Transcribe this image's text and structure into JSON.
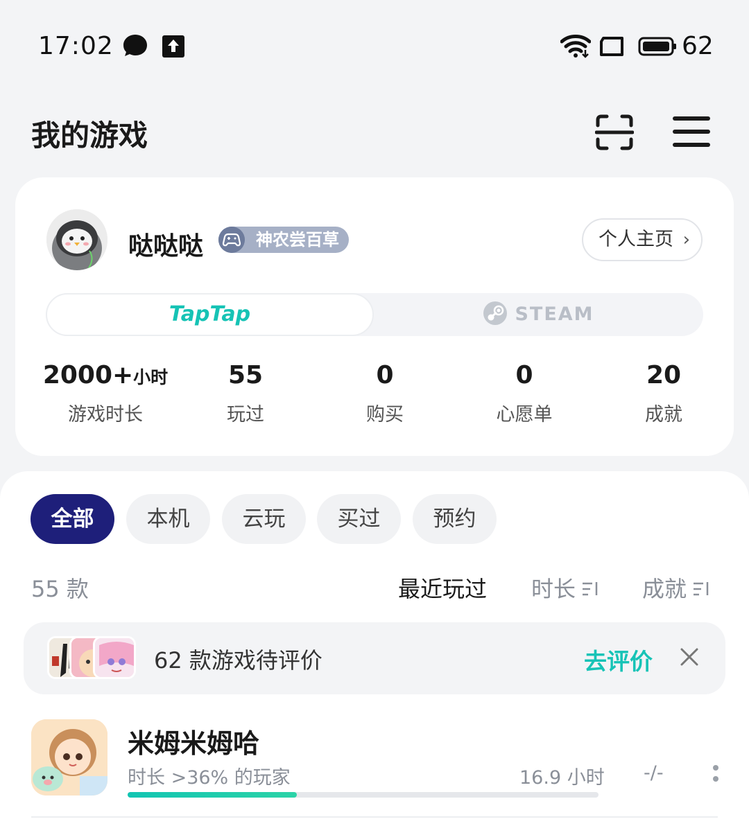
{
  "status_bar": {
    "time": "17:02",
    "battery": "62",
    "icons": [
      "chat-bubble-icon",
      "upload-icon",
      "wifi-icon",
      "screen-cast-icon",
      "battery-icon"
    ]
  },
  "header": {
    "title": "我的游戏",
    "icons": [
      "scan-icon",
      "menu-icon"
    ]
  },
  "profile": {
    "username": "哒哒哒",
    "badge": "神农尝百草",
    "profile_button": "个人主页",
    "chevron": "›"
  },
  "platforms": {
    "taptap": "TapTap",
    "steam": "STEAM",
    "active": "taptap"
  },
  "stats": [
    {
      "value": "2000+",
      "unit": "小时",
      "label": "游戏时长"
    },
    {
      "value": "55",
      "unit": "",
      "label": "玩过"
    },
    {
      "value": "0",
      "unit": "",
      "label": "购买"
    },
    {
      "value": "0",
      "unit": "",
      "label": "心愿单"
    },
    {
      "value": "20",
      "unit": "",
      "label": "成就"
    }
  ],
  "filters": [
    "全部",
    "本机",
    "云玩",
    "买过",
    "预约"
  ],
  "active_filter": "全部",
  "list": {
    "count": "55 款",
    "sort_recent": "最近玩过",
    "sort_duration": "时长",
    "sort_achievement": "成就"
  },
  "review_bar": {
    "text": "62 款游戏待评价",
    "link": "去评价"
  },
  "games": [
    {
      "name": "米姆米姆哈",
      "rank": "时长 >36% 的玩家",
      "time": "16.9 小时",
      "rating": "-/-",
      "progress": 0.36
    }
  ],
  "colors": {
    "accent": "#17c3b6",
    "active_chip": "#1e1f7a",
    "badge": "#a6b0c6"
  }
}
